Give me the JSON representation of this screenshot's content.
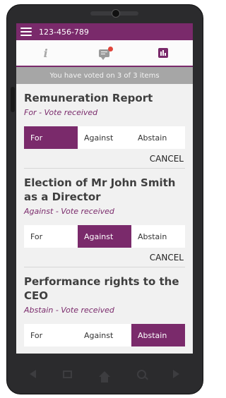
{
  "topbar": {
    "phone_number": "123-456-789"
  },
  "tabs": [
    {
      "id": "info",
      "icon": "info-icon"
    },
    {
      "id": "messages",
      "icon": "chat-icon",
      "has_notification": true
    },
    {
      "id": "results",
      "icon": "bar-chart-icon",
      "active": true
    }
  ],
  "status_banner": "You have voted on 3 of 3 items",
  "items": [
    {
      "title": "Remuneration Report",
      "status": "For - Vote received",
      "options": [
        "For",
        "Against",
        "Abstain"
      ],
      "selected": "For",
      "cancel_label": "CANCEL"
    },
    {
      "title": "Election of Mr John Smith as a Director",
      "status": "Against - Vote received",
      "options": [
        "For",
        "Against",
        "Abstain"
      ],
      "selected": "Against",
      "cancel_label": "CANCEL"
    },
    {
      "title": "Performance rights to the CEO",
      "status": "Abstain - Vote received",
      "options": [
        "For",
        "Against",
        "Abstain"
      ],
      "selected": "Abstain"
    }
  ],
  "colors": {
    "accent": "#7a2a6b",
    "banner": "#a6a6a6",
    "notification": "#e0453b"
  }
}
